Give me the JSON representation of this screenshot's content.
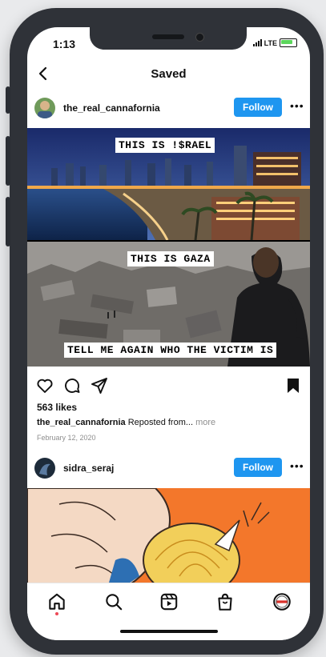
{
  "status_bar": {
    "time": "1:13",
    "network": "LTE"
  },
  "nav": {
    "title": "Saved",
    "back_icon": "chevron-left-icon"
  },
  "post1": {
    "username": "the_real_cannafornia",
    "follow_label": "Follow",
    "more_label": "•••",
    "image": {
      "caption_top": "THIS IS !$RAEL",
      "caption_middle": "THIS IS GAZA",
      "caption_bottom": "TELL ME AGAIN WHO THE VICTIM IS"
    },
    "likes": "563 likes",
    "caption_user": "the_real_cannafornia",
    "caption_text": "Reposted from...",
    "caption_more": "more",
    "date": "February 12, 2020"
  },
  "post2": {
    "username": "sidra_seraj",
    "follow_label": "Follow",
    "more_label": "•••"
  },
  "tabbar": {
    "items": [
      "home-icon",
      "search-icon",
      "reels-icon",
      "shop-icon",
      "profile-icon"
    ]
  },
  "colors": {
    "follow_blue": "#1e96f0",
    "notification_dot": "#ed4956",
    "post2_background": "#f3772b"
  }
}
